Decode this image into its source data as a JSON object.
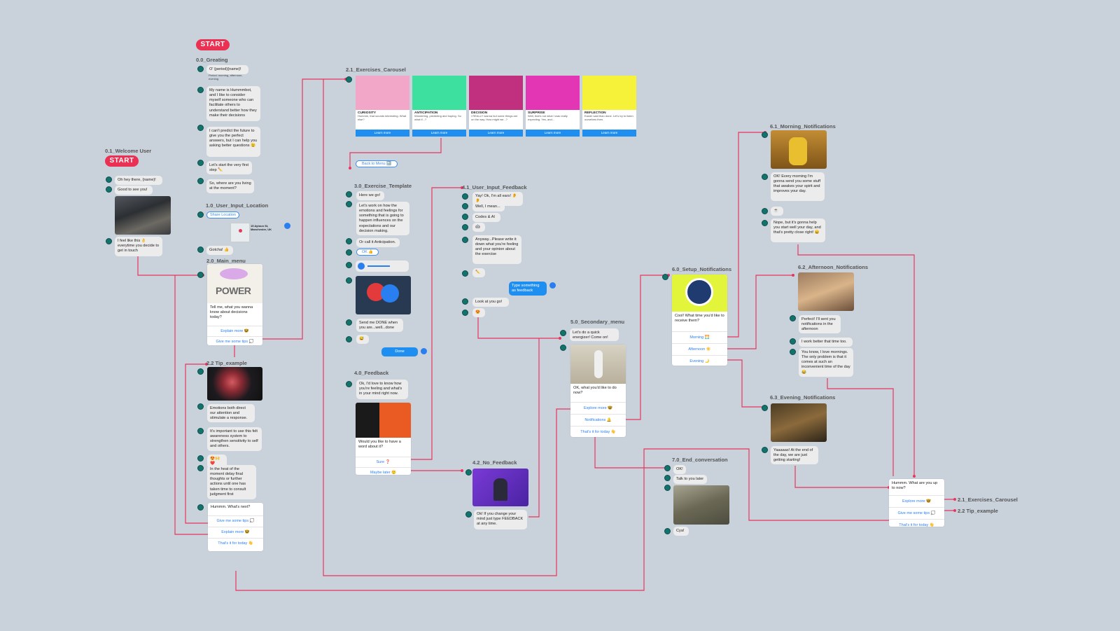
{
  "start_label": "START",
  "titles": {
    "welcome": "0.1_Welcome User",
    "greeting": "0.0_Greating",
    "location": "1.0_User_Input_Location",
    "main_menu": "2.0_Main_menu",
    "tip_example": "2.2 Tip_example",
    "carousel": "2.1_Exercises_Carousel",
    "exercise_template": "3.0_Exercise_Template",
    "feedback": "4.0_Feedback",
    "user_input_feedback": "4.1_User_Input_Feedback",
    "no_feedback": "4.2_No_Feedback",
    "secondary_menu": "5.0_Secondary_menu",
    "setup_notifications": "6.0_Setup_Notifications",
    "morning": "6.1_Morning_Notifications",
    "afternoon": "6.2_Afternoon_Notifications",
    "evening": "6.3_Evening_Notifications",
    "end_conversation": "7.0_End_conversation"
  },
  "welcome": {
    "m1": "Oh hey there, {name}!",
    "m2": "Good to see you!",
    "m3": "I feel like this 👌 everytime you decide to get in touch"
  },
  "greeting": {
    "m1": "O' {period}{name}!",
    "period_note": "Period: morning, afternoon, evening",
    "m2": "My name is Hummmbot, and I like to consider myself someone who can facilitate others to understand better how they make their decisions",
    "m3": "I can't predict the future to give you the perfect answers, but I can help you asking better questions 😉",
    "m4": "Let's start the very first step ✏️",
    "m5": "So, where are you living at the moment?"
  },
  "location": {
    "share_btn": "Share Location",
    "address": "15 Aytoun St, Manchester, UK",
    "gotcha": "Gotcha! 👍"
  },
  "main_menu": {
    "img_text": "POWER",
    "msg": "Tell me, what you wanna know about decisions today?",
    "opt1": "Explain more 🤓",
    "opt2": "Give me some tips 💭"
  },
  "tip": {
    "m1": "Emotions both direct our attention and stimulate a response.",
    "m2": "It's important to use this felt awareness system to strengthen sensitivity to self and others.",
    "m3": "😍🙌❤️",
    "m4": "In the heat of the moment delay final thoughts or further actions until one has taken time to consult judgment first",
    "menu_msg": "Hummm. What's next?",
    "opt1": "Give me some tips 💭",
    "opt2": "Explain more 🤓",
    "opt3": "That's it for today 👋"
  },
  "carousel": [
    {
      "name": "CURIOSITY",
      "desc": "Hummm, that sounds interesting. What else?",
      "btn": "Learn more",
      "bg": "#f2a6c8"
    },
    {
      "name": "ANTICIPATION",
      "desc": "Wondering, predicting and hoping. So what if...?",
      "btn": "Learn more",
      "bg": "#3ee0a0"
    },
    {
      "name": "DECISION",
      "desc": "I REALLY wanna but some things are on the way. How might we...?",
      "btn": "Learn more",
      "bg": "#c12f7f"
    },
    {
      "name": "SURPRISE",
      "desc": "Well, that's not what I was really expecting. Yes, and...",
      "btn": "Learn more",
      "bg": "#e236b4"
    },
    {
      "name": "REFLECTION",
      "desc": "Easier said than done. Let's try to listen ourselves then.",
      "btn": "Learn more",
      "bg": "#f6f23a"
    }
  ],
  "exercise": {
    "back_btn": "Back to Menu 🔙",
    "m1": "Here we go!",
    "m2": "Let's work on how the emotions and feelings for something that is going to happen influences on the expectations and our decision making.",
    "m3": "Or call it Anticipation.",
    "ok_btn": "OK 👍",
    "m4": "Send me DONE when you are...well...done",
    "m5": "😅",
    "done": "Done"
  },
  "feedback": {
    "m1": "Ok, I'd love to know how you're feeling and what's in your mind right now.",
    "msg": "Would you like to have a word about it?",
    "opt1": "Sure ❓",
    "opt2": "Maybe later 🙂"
  },
  "user_feedback": {
    "m1": "Yay! Ok, I'm all ears! 👂👂",
    "m2": "Well, I mean...",
    "m3": "Codes & AI",
    "m4": "🤖",
    "m5": "Anyway...Please write it down what you're feeling and your opinion about the exercise",
    "m6": "✏️",
    "user_msg": "Type something as feedback",
    "m7": "Look at you go!",
    "m8": "😍"
  },
  "no_feedback": {
    "m1": "Ok! If you change your mind just type FEEDBACK at any time."
  },
  "secondary": {
    "m1": "Let's do a quick energizer! Come on!",
    "msg": "OK, what you'd like to do now?",
    "opt1": "Explore more 🤓",
    "opt2": "Notifications 🔔",
    "opt3": "That's it for today 👋"
  },
  "setup": {
    "msg": "Cool! What time you'd like to receive them?",
    "opt1": "Morning 🌅",
    "opt2": "Afternoon ☀️",
    "opt3": "Evening 🌙"
  },
  "morning": {
    "m1": "OK! Every morning I'm gonna send you some stuff that awakes your spirit and improves your day.",
    "m2": "☕",
    "m3": "Nope, but it's gonna help you start well your day, and that's pretty close right! 😄"
  },
  "afternoon": {
    "m1": "Perfect! I'll sent you notifications in the afternoon",
    "m2": "I work better that time too.",
    "m3": "You know, I love mornings. The only problem is that it comes at such an inconvenient time of the day 😂"
  },
  "evening": {
    "m1": "Yaaaaas! At the end of the day, we are just getting starting!"
  },
  "end": {
    "m1": "OK!",
    "m2": "Talk to you later",
    "m3": "Cya!"
  },
  "final_menu": {
    "msg": "Hummm. What are you up to now?",
    "opt1": "Explore more 🤓",
    "opt2": "Give me some tips 💭",
    "opt3": "That's it for today 👋",
    "link1": "2.1_Exercises_Carousel",
    "link2": "2.2 Tip_example"
  },
  "colors": {
    "background": "#c9d1db",
    "connector": "#e8365d",
    "avatar": "#14726c",
    "option_text": "#2a7ff0",
    "start": "#ea3154"
  }
}
